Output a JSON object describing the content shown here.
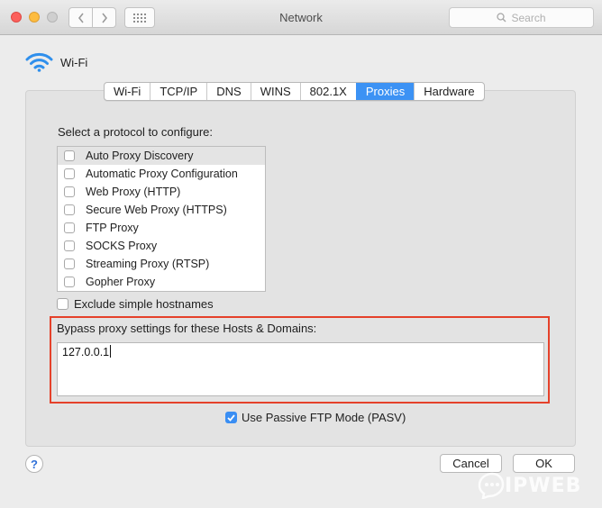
{
  "window": {
    "title": "Network"
  },
  "search": {
    "placeholder": "Search"
  },
  "header": {
    "service": "Wi-Fi"
  },
  "tabs": [
    {
      "label": "Wi-Fi",
      "active": false
    },
    {
      "label": "TCP/IP",
      "active": false
    },
    {
      "label": "DNS",
      "active": false
    },
    {
      "label": "WINS",
      "active": false
    },
    {
      "label": "802.1X",
      "active": false
    },
    {
      "label": "Proxies",
      "active": true
    },
    {
      "label": "Hardware",
      "active": false
    }
  ],
  "protocols": {
    "label": "Select a protocol to configure:",
    "items": [
      {
        "label": "Auto Proxy Discovery",
        "checked": false,
        "selected": true
      },
      {
        "label": "Automatic Proxy Configuration",
        "checked": false,
        "selected": false
      },
      {
        "label": "Web Proxy (HTTP)",
        "checked": false,
        "selected": false
      },
      {
        "label": "Secure Web Proxy (HTTPS)",
        "checked": false,
        "selected": false
      },
      {
        "label": "FTP Proxy",
        "checked": false,
        "selected": false
      },
      {
        "label": "SOCKS Proxy",
        "checked": false,
        "selected": false
      },
      {
        "label": "Streaming Proxy (RTSP)",
        "checked": false,
        "selected": false
      },
      {
        "label": "Gopher Proxy",
        "checked": false,
        "selected": false
      }
    ]
  },
  "exclude": {
    "label": "Exclude simple hostnames",
    "checked": false
  },
  "bypass": {
    "label": "Bypass proxy settings for these Hosts & Domains:",
    "value": "127.0.0.1"
  },
  "pasv": {
    "label": "Use Passive FTP Mode (PASV)",
    "checked": true
  },
  "buttons": {
    "help": "?",
    "cancel": "Cancel",
    "ok": "OK"
  },
  "watermark": {
    "text": "IPWEB"
  },
  "colors": {
    "accent": "#3c92f4",
    "highlight_border": "#e5412a"
  }
}
